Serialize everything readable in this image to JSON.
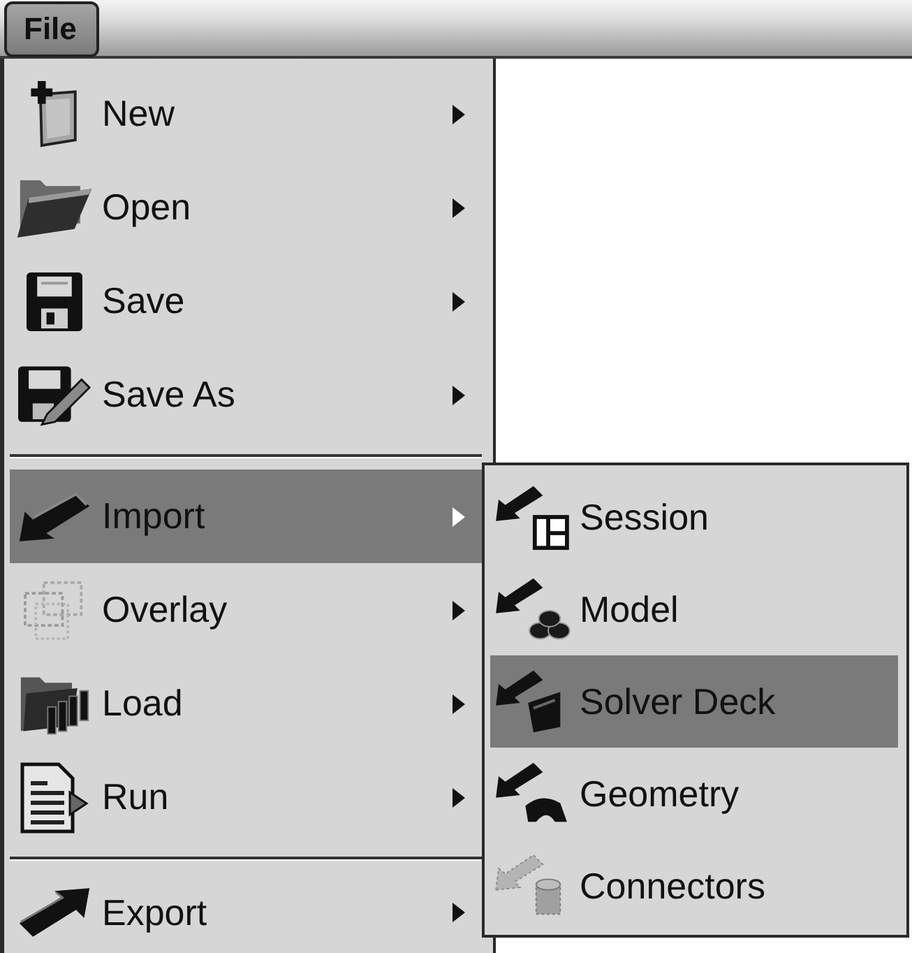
{
  "menu_bar": {
    "items": [
      {
        "label": "File",
        "selected": true
      }
    ]
  },
  "file_menu": {
    "groups": [
      {
        "items": [
          {
            "label": "New",
            "selected": false,
            "has_submenu": true
          },
          {
            "label": "Open",
            "selected": false,
            "has_submenu": true
          },
          {
            "label": "Save",
            "selected": false,
            "has_submenu": true
          },
          {
            "label": "Save As",
            "selected": false,
            "has_submenu": true
          }
        ]
      },
      {
        "items": [
          {
            "label": "Import",
            "selected": true,
            "has_submenu": true
          },
          {
            "label": "Overlay",
            "selected": false,
            "has_submenu": true
          },
          {
            "label": "Load",
            "selected": false,
            "has_submenu": true
          },
          {
            "label": "Run",
            "selected": false,
            "has_submenu": true
          }
        ]
      },
      {
        "items": [
          {
            "label": "Export",
            "selected": false,
            "has_submenu": true
          }
        ]
      }
    ]
  },
  "import_submenu": {
    "items": [
      {
        "label": "Session",
        "selected": false
      },
      {
        "label": "Model",
        "selected": false
      },
      {
        "label": "Solver Deck",
        "selected": true
      },
      {
        "label": "Geometry",
        "selected": false
      },
      {
        "label": "Connectors",
        "selected": false
      }
    ]
  }
}
